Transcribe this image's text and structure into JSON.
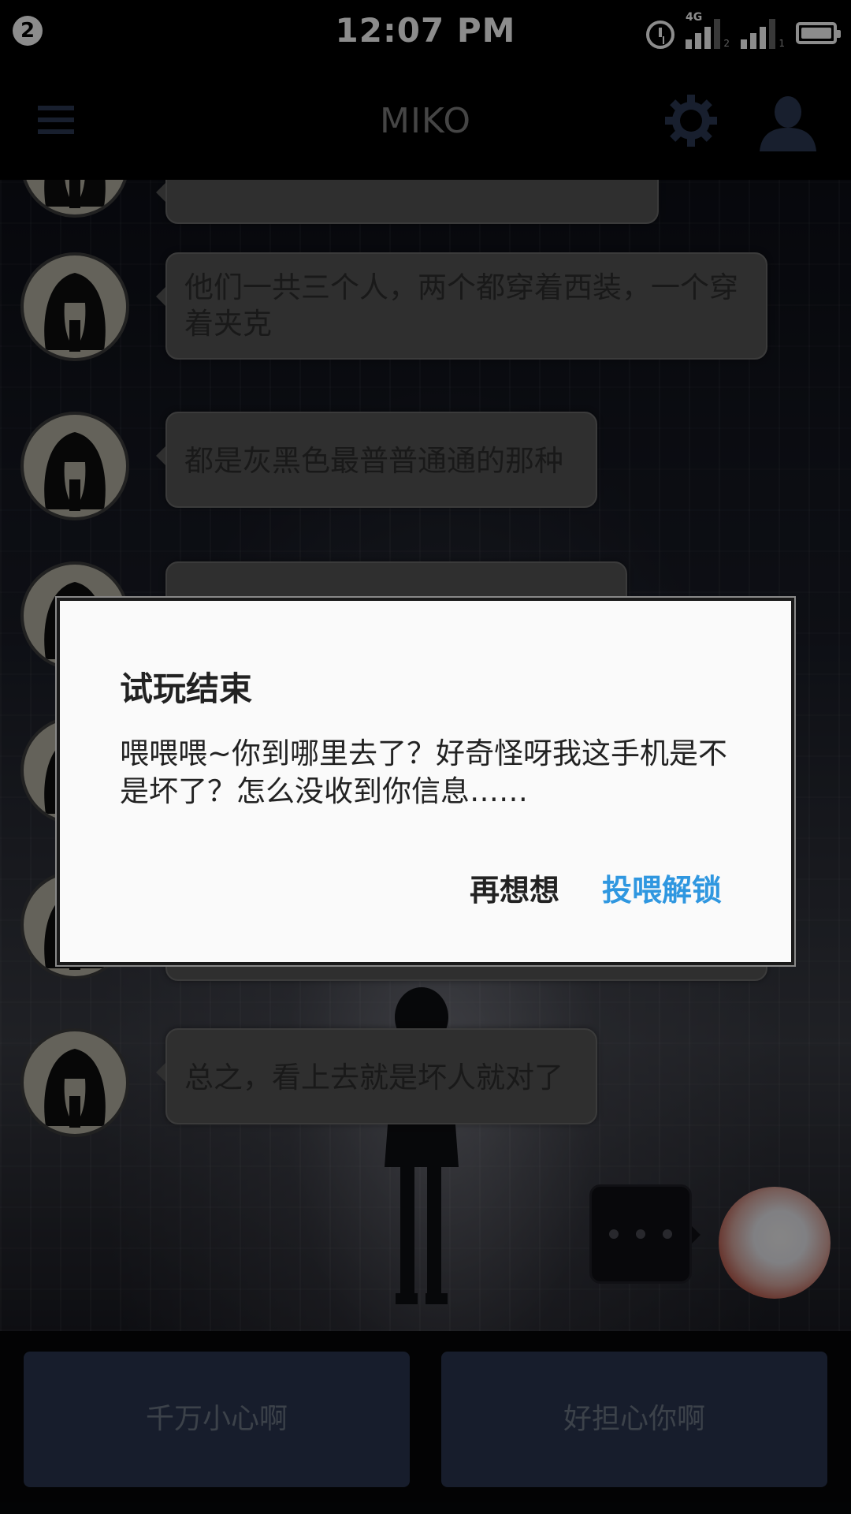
{
  "status_bar": {
    "notification_count": "2",
    "time": "12:07 PM",
    "network_type": "4G",
    "sim_slot_1": "2",
    "sim_slot_2": "1",
    "icons": [
      "alarm-icon",
      "signal-icon",
      "signal-icon",
      "battery-icon"
    ]
  },
  "app_bar": {
    "title": "MIKO",
    "icons": [
      "menu-icon",
      "gear-icon",
      "user-icon"
    ]
  },
  "chat": {
    "messages": [
      {
        "sender": "contact",
        "text": ""
      },
      {
        "sender": "contact",
        "text": "他们一共三个人，两个都穿着西装，一个穿着夹克"
      },
      {
        "sender": "contact",
        "text": "都是灰黑色最普普通通的那种"
      },
      {
        "sender": "contact",
        "text": ""
      },
      {
        "sender": "contact",
        "text": ""
      },
      {
        "sender": "contact",
        "text": ""
      },
      {
        "sender": "contact",
        "text": "总之，看上去就是坏人就对了"
      }
    ],
    "typing_indicator": "..."
  },
  "replies": {
    "option_1": "千万小心啊",
    "option_2": "好担心你啊"
  },
  "dialog": {
    "title": "试玩结束",
    "body": "喂喂喂~你到哪里去了？好奇怪呀我这手机是不是坏了？怎么没收到你信息……",
    "cancel_label": "再想想",
    "confirm_label": "投喂解锁",
    "confirm_color": "#2f97e0"
  },
  "colors": {
    "app_bar_icon": "#2c3a55",
    "reply_button_bg": "#2a3550",
    "bubble_bg": "#575757"
  }
}
